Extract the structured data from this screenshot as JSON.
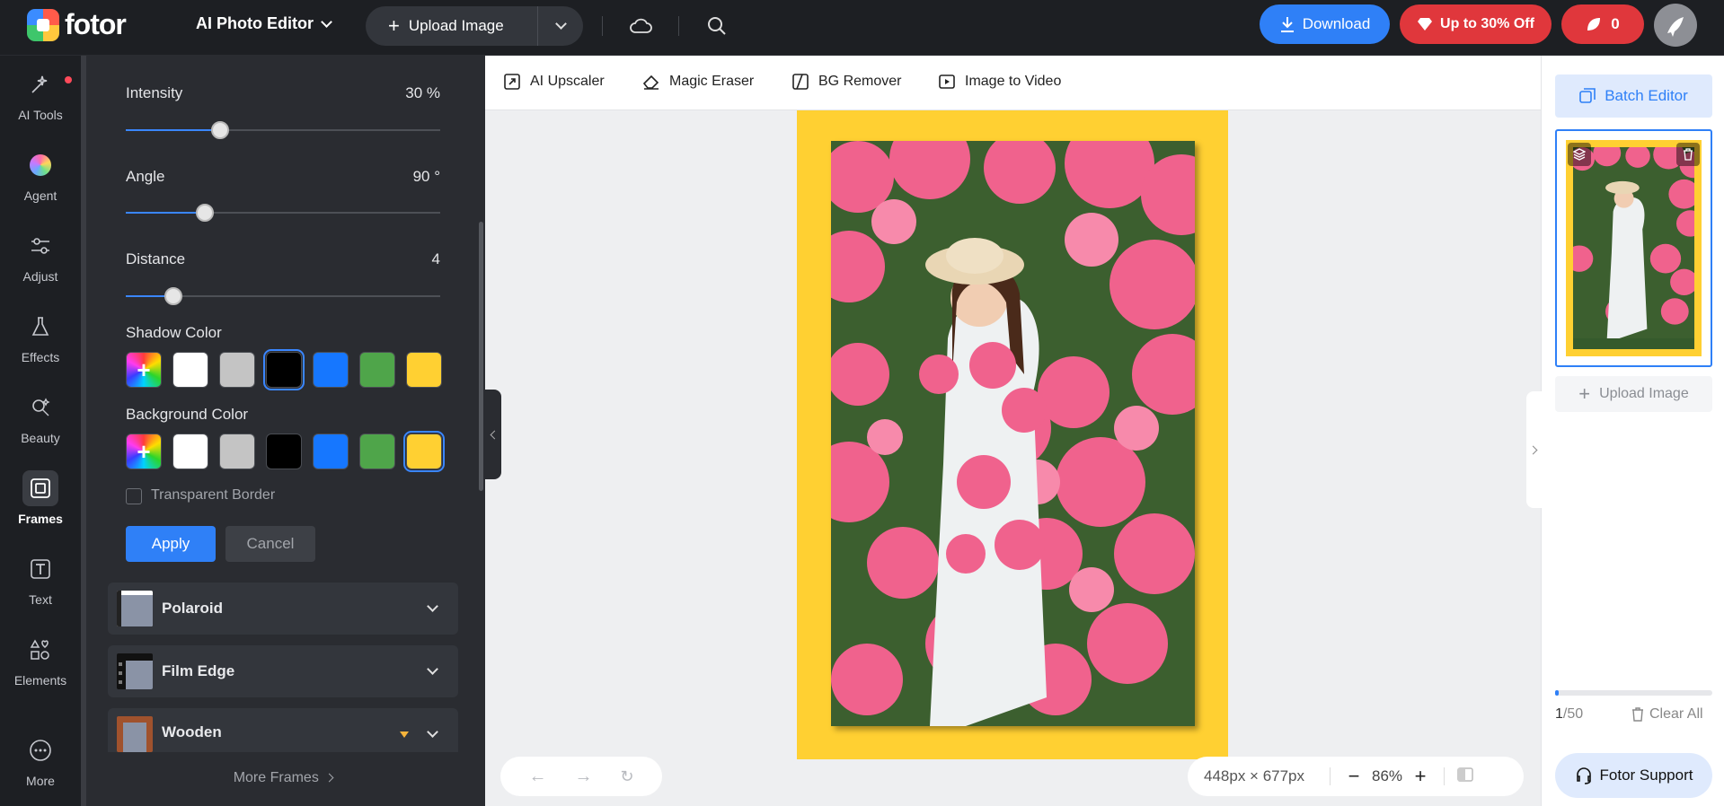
{
  "header": {
    "logo_text": "fotor",
    "app_title": "AI Photo Editor",
    "upload_label": "Upload Image",
    "download_label": "Download",
    "offer_label": "Up to 30% Off",
    "credits": "0"
  },
  "rail": {
    "items": [
      {
        "label": "AI Tools",
        "icon": "sparkle-icon"
      },
      {
        "label": "Agent",
        "icon": "agent-orb-icon"
      },
      {
        "label": "Adjust",
        "icon": "sliders-icon"
      },
      {
        "label": "Effects",
        "icon": "flask-icon"
      },
      {
        "label": "Beauty",
        "icon": "beauty-icon"
      },
      {
        "label": "Frames",
        "icon": "frame-icon"
      },
      {
        "label": "Text",
        "icon": "text-icon"
      },
      {
        "label": "Elements",
        "icon": "shapes-icon"
      },
      {
        "label": "More",
        "icon": "more-icon"
      }
    ],
    "active": "Frames"
  },
  "panel": {
    "intensity": {
      "label": "Intensity",
      "value": "30 %",
      "fraction": 0.3
    },
    "angle": {
      "label": "Angle",
      "value": "90 °",
      "fraction": 0.25
    },
    "distance": {
      "label": "Distance",
      "value": "4",
      "fraction": 0.15
    },
    "shadow_color": {
      "label": "Shadow Color",
      "colors": [
        "#ffffff",
        "#c4c4c4",
        "#000000",
        "#1677ff",
        "#4fa54a",
        "#ffd032"
      ],
      "selected": "#000000"
    },
    "background_color": {
      "label": "Background Color",
      "colors": [
        "#ffffff",
        "#c4c4c4",
        "#000000",
        "#1677ff",
        "#4fa54a",
        "#ffd032"
      ],
      "selected": "#ffd032"
    },
    "transparent_border": "Transparent Border",
    "apply": "Apply",
    "cancel": "Cancel",
    "frames": [
      {
        "name": "Polaroid"
      },
      {
        "name": "Film Edge"
      },
      {
        "name": "Wooden"
      }
    ],
    "more_frames": "More Frames"
  },
  "toolbar": {
    "items": [
      {
        "label": "AI Upscaler",
        "icon": "upscale-icon"
      },
      {
        "label": "Magic Eraser",
        "icon": "eraser-icon"
      },
      {
        "label": "BG Remover",
        "icon": "bg-remover-icon"
      },
      {
        "label": "Image to Video",
        "icon": "video-icon"
      }
    ]
  },
  "canvas": {
    "dimensions": "448px × 677px",
    "zoom": "86%",
    "frame_color": "#ffd032"
  },
  "right_panel": {
    "batch_label": "Batch Editor",
    "upload_label": "Upload Image",
    "count_current": "1",
    "count_total": "/50",
    "progress_fraction": 0.02,
    "clear_all": "Clear All",
    "support_label": "Fotor Support"
  }
}
